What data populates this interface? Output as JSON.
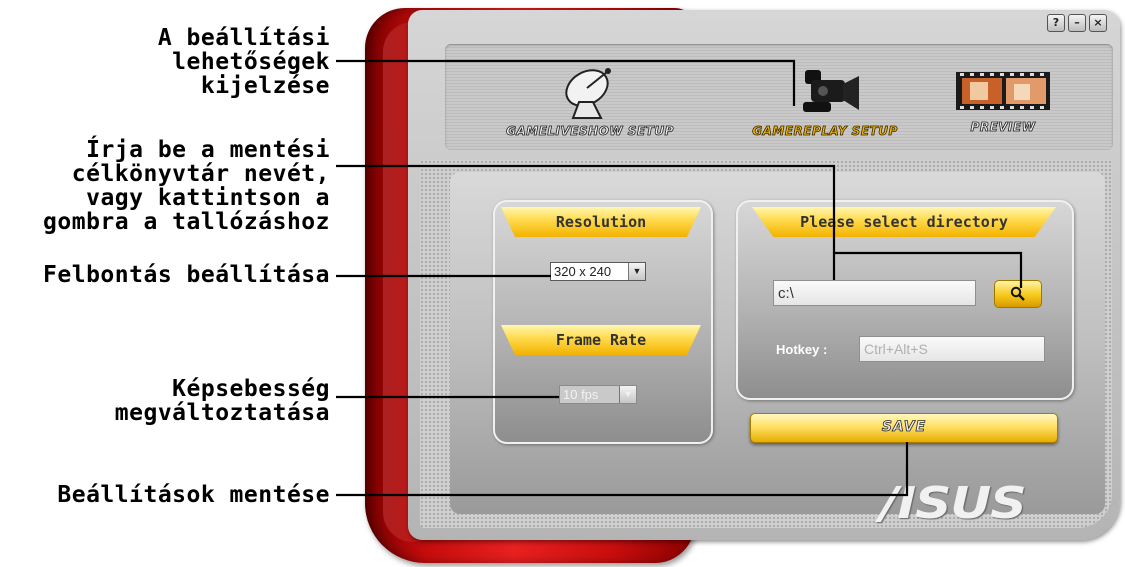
{
  "annotations": {
    "display": [
      "A beállítási",
      "lehetőségek",
      "kijelzése"
    ],
    "directory": [
      "Írja be a mentési",
      "célkönyvtár nevét,",
      "vagy kattintson a",
      "gombra a tallózáshoz"
    ],
    "resolution": [
      "Felbontás beállítása"
    ],
    "frame_rate": [
      "Képsebesség",
      "megváltoztatása"
    ],
    "save": [
      "Beállítások mentése"
    ]
  },
  "window_controls": [
    "?",
    "–",
    "×"
  ],
  "toolbar": {
    "items": [
      {
        "label": "GAMELIVESHOW SETUP",
        "icon": "satellite-dish-icon",
        "active": false
      },
      {
        "label": "GAMEREPLAY SETUP",
        "icon": "video-camera-icon",
        "active": true
      },
      {
        "label": "PREVIEW",
        "icon": "film-strip-icon",
        "active": false
      }
    ]
  },
  "settings": {
    "resolution_title": "Resolution",
    "resolution_value": "320 x 240",
    "frame_rate_title": "Frame Rate",
    "frame_rate_value": "10 fps"
  },
  "directory": {
    "title": "Please select directory",
    "path_value": "c:\\",
    "hotkey_label": "Hotkey :",
    "hotkey_value": "Ctrl+Alt+S"
  },
  "save_label": "SAVE",
  "brand": "/ISUS",
  "colors": {
    "frame_red": "#d81414",
    "accent_yellow": "#f7c819",
    "active_label": "#f3b90a"
  }
}
